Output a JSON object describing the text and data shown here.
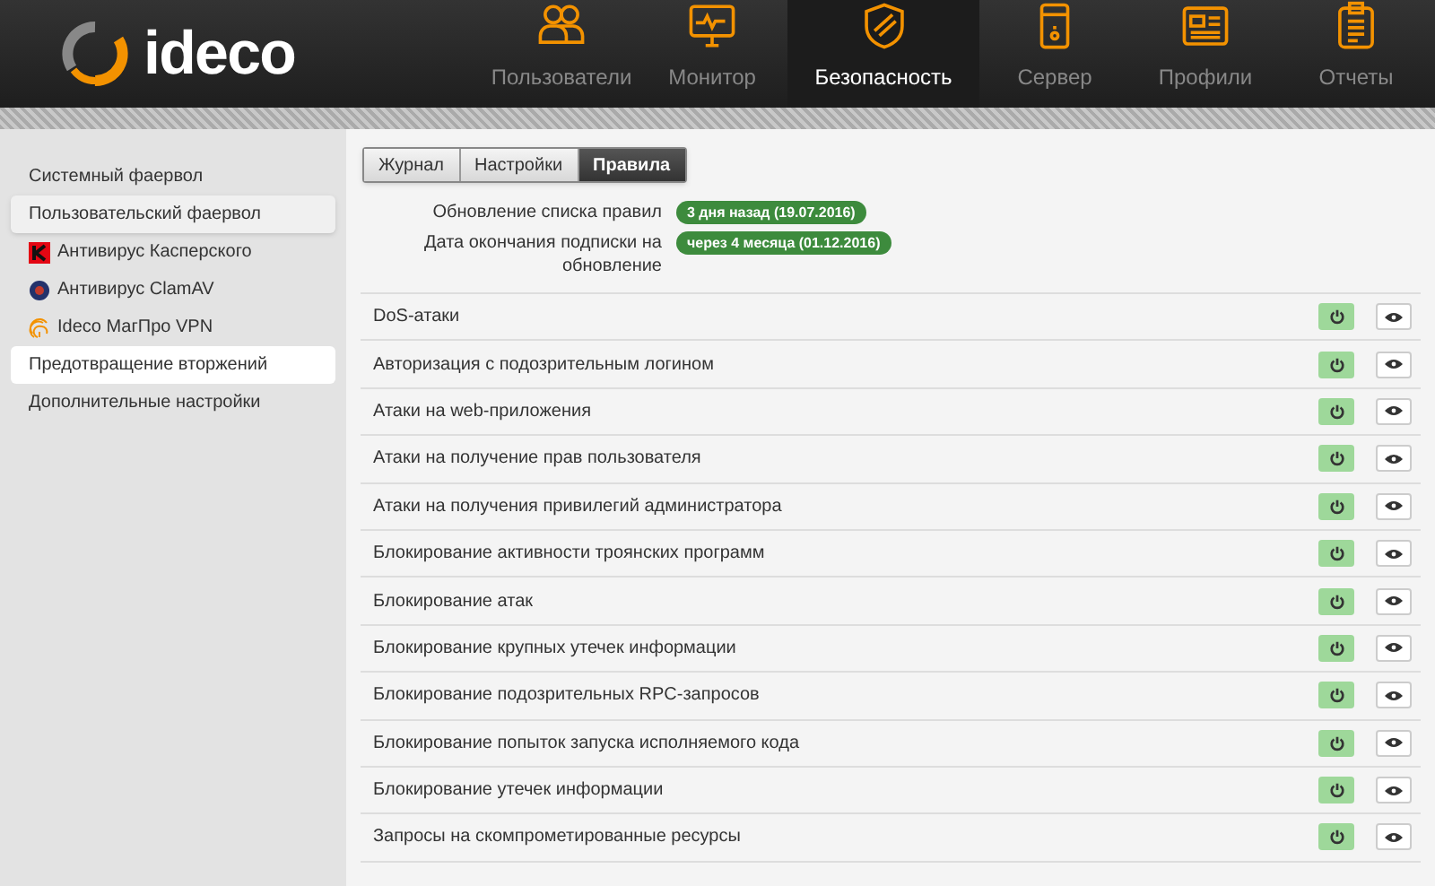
{
  "logo": {
    "text": "ideco"
  },
  "nav": [
    {
      "label": "Пользователи",
      "kind": "users",
      "selected": false
    },
    {
      "label": "Монитор",
      "kind": "monitor",
      "selected": false
    },
    {
      "label": "Безопасность",
      "kind": "shield",
      "selected": true
    },
    {
      "label": "Сервер",
      "kind": "server",
      "selected": false
    },
    {
      "label": "Профили",
      "kind": "profile",
      "selected": false
    },
    {
      "label": "Отчеты",
      "kind": "report",
      "selected": false
    }
  ],
  "sidebar": {
    "items": [
      {
        "label": "Системный фаервол",
        "kind": "plain",
        "selected": false,
        "hovered": false
      },
      {
        "label": "Пользовательский фаервол",
        "kind": "plain",
        "selected": false,
        "hovered": true
      },
      {
        "label": "Антивирус Касперского",
        "kind": "kaspersky",
        "selected": false,
        "hovered": false
      },
      {
        "label": "Антивирус ClamAV",
        "kind": "clamav",
        "selected": false,
        "hovered": false
      },
      {
        "label": "Ideco МагПро VPN",
        "kind": "fingerprint",
        "selected": false,
        "hovered": false
      },
      {
        "label": "Предотвращение вторжений",
        "kind": "plain",
        "selected": true,
        "hovered": false
      },
      {
        "label": "Дополнительные настройки",
        "kind": "plain",
        "selected": false,
        "hovered": false
      }
    ]
  },
  "tabs": [
    {
      "label": "Журнал",
      "selected": false
    },
    {
      "label": "Настройки",
      "selected": false
    },
    {
      "label": "Правила",
      "selected": true
    }
  ],
  "info": [
    {
      "label": "Обновление списка правил",
      "badge": "3 дня назад (19.07.2016)"
    },
    {
      "label": "Дата окончания подписки на обновление",
      "badge": "через 4 месяца (01.12.2016)"
    }
  ],
  "rules": [
    {
      "name": "DoS-атаки",
      "enabled": true
    },
    {
      "name": "Авторизация с подозрительным логином",
      "enabled": true
    },
    {
      "name": "Атаки на web-приложения",
      "enabled": true
    },
    {
      "name": "Атаки на получение прав пользователя",
      "enabled": true
    },
    {
      "name": "Атаки на получения привилегий администратора",
      "enabled": true
    },
    {
      "name": "Блокирование активности троянских программ",
      "enabled": true
    },
    {
      "name": "Блокирование атак",
      "enabled": true
    },
    {
      "name": "Блокирование крупных утечек информации",
      "enabled": true
    },
    {
      "name": "Блокирование подозрительных RPC-запросов",
      "enabled": true
    },
    {
      "name": "Блокирование попыток запуска исполняемого кода",
      "enabled": true
    },
    {
      "name": "Блокирование утечек информации",
      "enabled": true
    },
    {
      "name": "Запросы на скомпрометированные ресурсы",
      "enabled": true
    }
  ]
}
